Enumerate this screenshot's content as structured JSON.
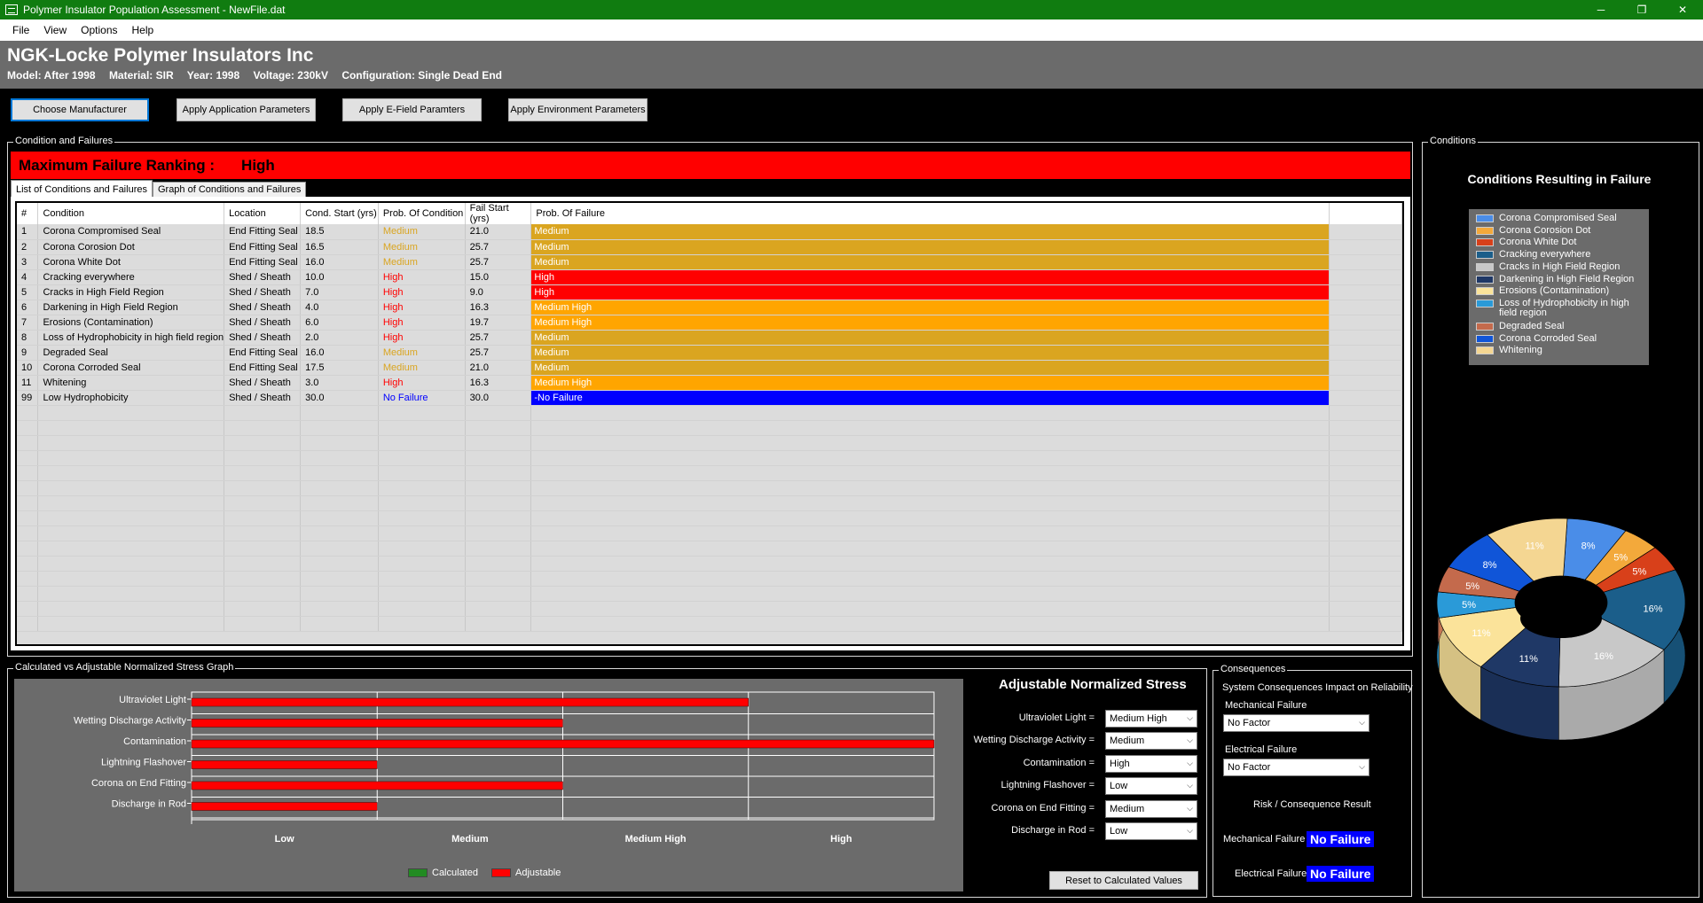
{
  "window": {
    "title": "Polymer Insulator Population Assessment - NewFile.dat",
    "minimize": "─",
    "restore": "❐",
    "close": "✕"
  },
  "menu": [
    "File",
    "View",
    "Options",
    "Help"
  ],
  "header": {
    "manufacturer": "NGK-Locke Polymer Insulators Inc",
    "model": "Model: After 1998",
    "material": "Material: SIR",
    "year": "Year: 1998",
    "voltage": "Voltage: 230kV",
    "configuration": "Configuration: Single Dead End"
  },
  "toolbar": {
    "choose_manufacturer": "Choose Manufacturer",
    "apply_application": "Apply Application Parameters",
    "apply_efield": "Apply E-Field Paramters",
    "apply_environment": "Apply Environment Parameters"
  },
  "conditions_group": {
    "label": "Condition and Failures",
    "ranking_label": "Maximum Failure Ranking :",
    "ranking_value": "High",
    "tabs": [
      "List of Conditions and Failures",
      "Graph of Conditions and Failures"
    ],
    "columns": [
      "#",
      "Condition",
      "Location",
      "Cond. Start (yrs)",
      "Prob. Of Condition",
      "Fail Start (yrs)",
      "Prob. Of Failure"
    ],
    "rows": [
      {
        "n": "1",
        "condition": "Corona Compromised Seal",
        "location": "End Fitting Seal",
        "cond_start": "18.5",
        "prob_cond": "Medium",
        "prob_cond_level": "medium",
        "fail_start": "21.0",
        "prob_fail": "Medium",
        "fail_color": "#daa520"
      },
      {
        "n": "2",
        "condition": "Corona Corosion Dot",
        "location": "End Fitting Seal",
        "cond_start": "16.5",
        "prob_cond": "Medium",
        "prob_cond_level": "medium",
        "fail_start": "25.7",
        "prob_fail": "Medium",
        "fail_color": "#daa520"
      },
      {
        "n": "3",
        "condition": "Corona White Dot",
        "location": "End Fitting Seal",
        "cond_start": "16.0",
        "prob_cond": "Medium",
        "prob_cond_level": "medium",
        "fail_start": "25.7",
        "prob_fail": "Medium",
        "fail_color": "#daa520"
      },
      {
        "n": "4",
        "condition": "Cracking everywhere",
        "location": "Shed / Sheath",
        "cond_start": "10.0",
        "prob_cond": "High",
        "prob_cond_level": "high",
        "fail_start": "15.0",
        "prob_fail": "High",
        "fail_color": "#ff0000"
      },
      {
        "n": "5",
        "condition": "Cracks in High Field Region",
        "location": "Shed / Sheath",
        "cond_start": "7.0",
        "prob_cond": "High",
        "prob_cond_level": "high",
        "fail_start": "9.0",
        "prob_fail": "High",
        "fail_color": "#ff0000"
      },
      {
        "n": "6",
        "condition": "Darkening in High Field Region",
        "location": "Shed / Sheath",
        "cond_start": "4.0",
        "prob_cond": "High",
        "prob_cond_level": "high",
        "fail_start": "16.3",
        "prob_fail": "Medium High",
        "fail_color": "#ffa500"
      },
      {
        "n": "7",
        "condition": "Erosions (Contamination)",
        "location": "Shed / Sheath",
        "cond_start": "6.0",
        "prob_cond": "High",
        "prob_cond_level": "high",
        "fail_start": "19.7",
        "prob_fail": "Medium High",
        "fail_color": "#ffa500"
      },
      {
        "n": "8",
        "condition": "Loss of Hydrophobicity in high field region",
        "location": "Shed / Sheath",
        "cond_start": "2.0",
        "prob_cond": "High",
        "prob_cond_level": "high",
        "fail_start": "25.7",
        "prob_fail": "Medium",
        "fail_color": "#daa520"
      },
      {
        "n": "9",
        "condition": "Degraded Seal",
        "location": "End Fitting Seal",
        "cond_start": "16.0",
        "prob_cond": "Medium",
        "prob_cond_level": "medium",
        "fail_start": "25.7",
        "prob_fail": "Medium",
        "fail_color": "#daa520"
      },
      {
        "n": "10",
        "condition": "Corona Corroded Seal",
        "location": "End Fitting Seal",
        "cond_start": "17.5",
        "prob_cond": "Medium",
        "prob_cond_level": "medium",
        "fail_start": "21.0",
        "prob_fail": "Medium",
        "fail_color": "#daa520"
      },
      {
        "n": "11",
        "condition": "Whitening",
        "location": "Shed / Sheath",
        "cond_start": "3.0",
        "prob_cond": "High",
        "prob_cond_level": "high",
        "fail_start": "16.3",
        "prob_fail": "Medium High",
        "fail_color": "#ffa500"
      },
      {
        "n": "99",
        "condition": "Low Hydrophobicity",
        "location": "Shed / Sheath",
        "cond_start": "30.0",
        "prob_cond": "No Failure",
        "prob_cond_level": "none",
        "fail_start": "30.0",
        "prob_fail": "-No Failure",
        "fail_color": "#0000ff"
      }
    ]
  },
  "stress_graph": {
    "label": "Calculated vs Adjustable Normalized Stress Graph",
    "legend_calculated": "Calculated",
    "legend_adjustable": "Adjustable",
    "color_calculated": "#228b22",
    "color_adjustable": "#ff0000"
  },
  "chart_data": {
    "type": "bar",
    "orientation": "horizontal",
    "categories": [
      "Ultraviolet Light",
      "Wetting Discharge Activity",
      "Contamination",
      "Lightning Flashover",
      "Corona on End Fitting",
      "Discharge in Rod"
    ],
    "x_tick_labels": [
      "Low",
      "Medium",
      "Medium High",
      "High"
    ],
    "xlim": [
      0,
      4
    ],
    "series": [
      {
        "name": "Adjustable",
        "values": [
          3,
          2,
          4,
          1,
          2,
          1
        ]
      }
    ]
  },
  "adjustable": {
    "title": "Adjustable Normalized Stress",
    "items": [
      {
        "label": "Ultraviolet Light =",
        "value": "Medium High"
      },
      {
        "label": "Wetting Discharge Activity =",
        "value": "Medium"
      },
      {
        "label": "Contamination =",
        "value": "High"
      },
      {
        "label": "Lightning Flashover =",
        "value": "Low"
      },
      {
        "label": "Corona on End Fitting =",
        "value": "Medium"
      },
      {
        "label": "Discharge in Rod =",
        "value": "Low"
      }
    ],
    "reset_label": "Reset to Calculated Values"
  },
  "consequences": {
    "label": "Consequences",
    "heading": "System Consequences Impact on Reliability",
    "mech_label": "Mechanical Failure",
    "mech_value": "No Factor",
    "elec_label": "Electrical Failure",
    "elec_value": "No Factor",
    "result_heading": "Risk / Consequence Result",
    "mech_result_label": "Mechanical Failure",
    "mech_result": "No Failure",
    "elec_result_label": "Electrical Failure",
    "elec_result": "No Failure"
  },
  "conditions_panel": {
    "label": "Conditions",
    "title": "Conditions Resulting in Failure",
    "legend": [
      {
        "name": "Corona Compromised Seal",
        "color": "#4a8de8"
      },
      {
        "name": "Corona Corosion Dot",
        "color": "#f3a93b"
      },
      {
        "name": "Corona White Dot",
        "color": "#d8401a"
      },
      {
        "name": "Cracking everywhere",
        "color": "#1b5e8a"
      },
      {
        "name": "Cracks in High Field Region",
        "color": "#c8c8c8"
      },
      {
        "name": "Darkening in High Field Region",
        "color": "#1f3866"
      },
      {
        "name": "Erosions (Contamination)",
        "color": "#fbe39a"
      },
      {
        "name": "Loss of Hydrophobicity in high field region",
        "color": "#2a9ad8"
      },
      {
        "name": "Degraded Seal",
        "color": "#c46a4c"
      },
      {
        "name": "Corona Corroded Seal",
        "color": "#1055d8"
      },
      {
        "name": "Whitening",
        "color": "#f4d692"
      }
    ],
    "pie_values": [
      8,
      5,
      5,
      16,
      16,
      11,
      11,
      5,
      5,
      8,
      11
    ],
    "pie_labels": [
      "8%",
      "5%",
      "5%",
      "16%",
      "16%",
      "11%",
      "11%",
      "5%",
      "5%",
      "8%",
      "11%"
    ]
  }
}
